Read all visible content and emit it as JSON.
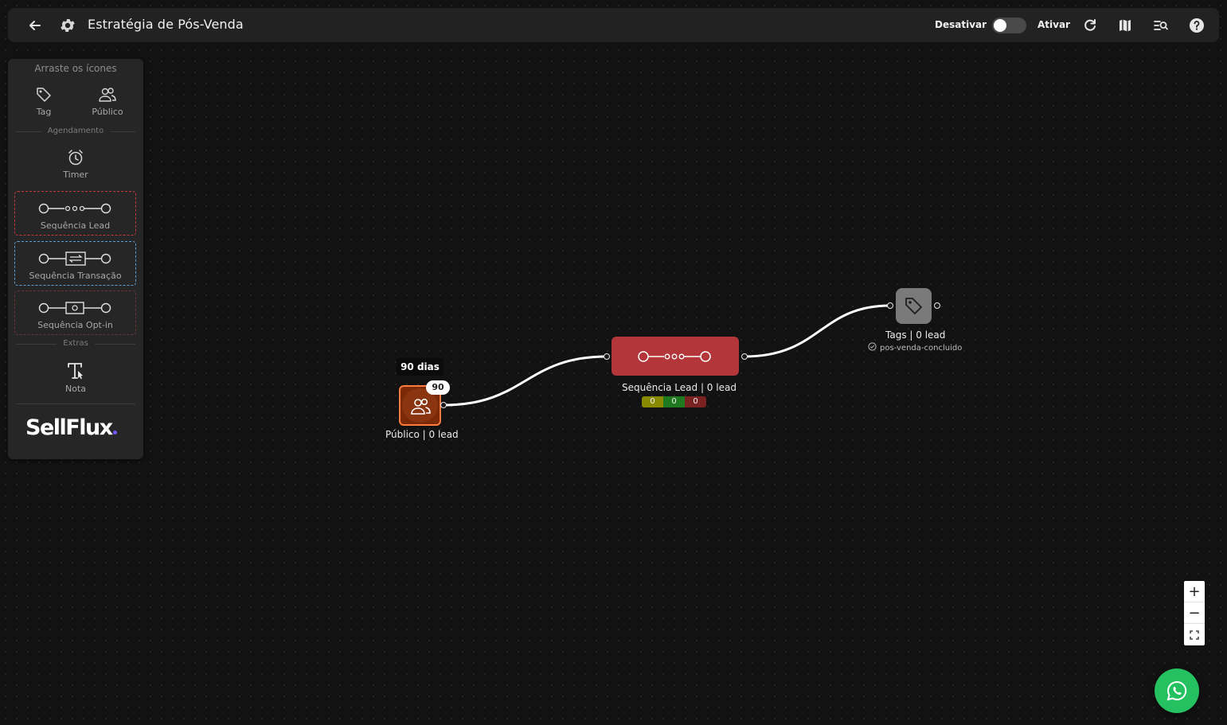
{
  "header": {
    "title": "Estratégia de Pós-Venda",
    "deactivate_label": "Desativar",
    "activate_label": "Ativar",
    "toggle_state": "off"
  },
  "sidebar": {
    "hint": "Arraste os ícones",
    "items": {
      "tag": "Tag",
      "publico": "Público",
      "timer": "Timer",
      "sequencia_lead": "Sequência Lead",
      "sequencia_transacao": "Sequência Transação",
      "sequencia_optin": "Sequência Opt-in",
      "nota": "Nota"
    },
    "sections": {
      "agendamento": "Agendamento",
      "extras": "Extras"
    },
    "logo": "SellFlux"
  },
  "canvas": {
    "publico_node": {
      "tooltip": "90 dias",
      "badge": "90",
      "label": "Público | 0 lead"
    },
    "sequencia_node": {
      "label": "Sequência Lead | 0 lead",
      "counters": [
        "0",
        "0",
        "0"
      ]
    },
    "tags_node": {
      "label": "Tags | 0 lead",
      "tag": "pos-venda-concluido"
    }
  },
  "zoom": {
    "in": "+",
    "out": "−"
  },
  "colors": {
    "accent_orange": "#ff7a3d",
    "seq_red": "#b3363a",
    "counter_yellow": "#8a8a00",
    "counter_green": "#1f7a1f",
    "counter_red": "#7a2222",
    "whatsapp": "#25c160"
  }
}
